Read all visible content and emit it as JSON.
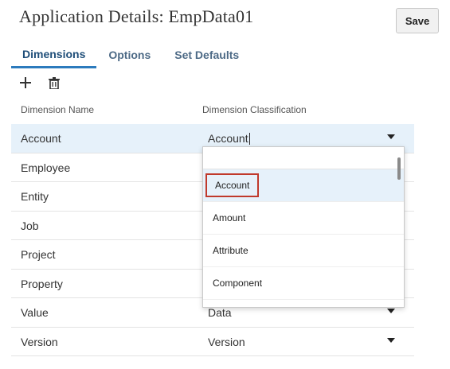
{
  "page": {
    "title": "Application Details: EmpData01"
  },
  "toolbar": {
    "save_label": "Save"
  },
  "tabs": [
    {
      "label": "Dimensions",
      "active": true
    },
    {
      "label": "Options",
      "active": false
    },
    {
      "label": "Set Defaults",
      "active": false
    }
  ],
  "icons": {
    "add": "plus-icon",
    "delete": "trash-icon"
  },
  "grid": {
    "headers": {
      "name": "Dimension Name",
      "classification": "Dimension Classification"
    },
    "rows": [
      {
        "name": "Account",
        "classification": "Account"
      },
      {
        "name": "Employee",
        "classification": ""
      },
      {
        "name": "Entity",
        "classification": ""
      },
      {
        "name": "Job",
        "classification": ""
      },
      {
        "name": "Project",
        "classification": ""
      },
      {
        "name": "Property",
        "classification": ""
      },
      {
        "name": "Value",
        "classification": "Data"
      },
      {
        "name": "Version",
        "classification": "Version"
      }
    ]
  },
  "dropdown": {
    "search_value": "",
    "options": [
      "Account",
      "Amount",
      "Attribute",
      "Component"
    ],
    "highlighted": "Account"
  },
  "colors": {
    "accent": "#2c7bbd",
    "tab_text": "#4d6a86",
    "selected_row": "#e6f1fa",
    "focus_outline": "#c0392b"
  }
}
